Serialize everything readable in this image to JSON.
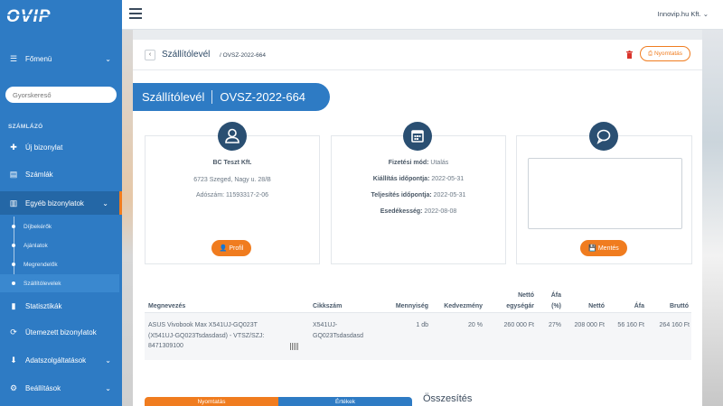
{
  "app": {
    "logo_text": "OVIP"
  },
  "sidebar": {
    "main_menu": "Főmenü",
    "search_placeholder": "Gyorskereső",
    "section": "SZÁMLÁZÓ",
    "items": [
      {
        "label": "Új bizonylat",
        "icon": "plus-icon"
      },
      {
        "label": "Számlák",
        "icon": "document-icon"
      },
      {
        "label": "Egyéb bizonylatok",
        "icon": "file-icon"
      }
    ],
    "sub_items": [
      {
        "label": "Díjbekérők"
      },
      {
        "label": "Ajánlatok"
      },
      {
        "label": "Megrendelők"
      },
      {
        "label": "Szállítólevelek"
      }
    ],
    "items_bottom": [
      {
        "label": "Statisztikák",
        "icon": "bar-chart-icon"
      },
      {
        "label": "Ütemezett bizonylatok",
        "icon": "refresh-icon"
      },
      {
        "label": "Adatszolgáltatások",
        "icon": "download-icon"
      },
      {
        "label": "Beállítások",
        "icon": "gear-icon"
      }
    ]
  },
  "topbar": {
    "company": "Innovip.hu Kft."
  },
  "breadcrumb": {
    "title": "Szállítólevél",
    "sub": "/ OVSZ-2022-664"
  },
  "header": {
    "print_label": "Nyomtatás",
    "doc_type": "Szállítólevél",
    "doc_number": "OVSZ-2022-664"
  },
  "partner": {
    "name": "BC Teszt Kft.",
    "address": "6723 Szeged, Nagy u. 28/B",
    "tax_label": "Adószám:",
    "tax_number": "11593317-2-06",
    "button": "Profil"
  },
  "dates": {
    "payment_label": "Fizetési mód:",
    "payment_value": "Utalás",
    "issue_label": "Kiállítás időpontja:",
    "issue_value": "2022-05-31",
    "fulfil_label": "Teljesítés időpontja:",
    "fulfil_value": "2022-05-31",
    "due_label": "Esedékesség:",
    "due_value": "2022-08-08"
  },
  "comment": {
    "button": "Mentés",
    "value": ""
  },
  "table": {
    "headers": {
      "name": "Megnevezés",
      "code": "Cikkszám",
      "qty": "Mennyiség",
      "discount": "Kedvezmény",
      "net_unit_1": "Nettó",
      "net_unit_2": "egységár",
      "vat_pct_1": "Áfa",
      "vat_pct_2": "(%)",
      "net": "Nettó",
      "vat": "Áfa",
      "gross": "Bruttó"
    },
    "row": {
      "name_1": "ASUS Vivobook Max X541UJ-GQ023T",
      "name_2": "(X541UJ-GQ023Tsdasdasd) - VTSZ/SZJ:",
      "name_3": "8471309100",
      "code_1": "X541UJ-",
      "code_2": "GQ023Tsdasdasd",
      "qty": "1 db",
      "discount": "20 %",
      "net_unit": "260 000 Ft",
      "vat_pct": "27%",
      "net": "208 000 Ft",
      "vat": "56 160 Ft",
      "gross": "264 160 Ft"
    }
  },
  "bottom": {
    "tab_left": "Nyomtatás",
    "tab_right": "Értékek",
    "summary_title": "Összesítés"
  },
  "colors": {
    "primary": "#2e7bc4",
    "accent": "#f07c1f",
    "dark": "#2a4f72"
  }
}
